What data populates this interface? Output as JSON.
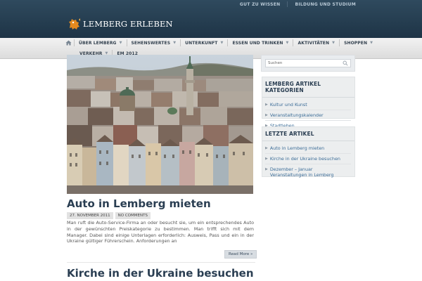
{
  "header": {
    "top_links": [
      "GUT ZU WISSEN",
      "BILDUNG UND STUDIUM"
    ],
    "logo_text": "LEMBERG ERLEBEN",
    "colors": {
      "header_bg": "#243c4f",
      "accent": "#e58a1f"
    }
  },
  "nav": {
    "home_icon": "home-icon",
    "items": [
      {
        "label": "ÜBER LEMBERG"
      },
      {
        "label": "SEHENSWERTES"
      },
      {
        "label": "UNTERKUNFT"
      },
      {
        "label": "ESSEN UND TRINKEN"
      },
      {
        "label": "AKTIVITÄTEN"
      },
      {
        "label": "SHOPPEN"
      },
      {
        "label": "VERKEHR"
      },
      {
        "label": "EM 2012"
      }
    ]
  },
  "posts": [
    {
      "title": "Auto in Lemberg mieten",
      "date": "27. NOVEMBER 2011",
      "comments": "NO COMMENTS",
      "excerpt": "Man ruft die Auto-Service-Firma an oder besucht sie, um ein entsprechendes Auto in der gewünschten Preiskategorie zu bestimmen. Man trifft sich mit dem Manager. Dabei sind einige Unterlagen erforderlich: Ausweis, Pass und ein in der Ukraine gültiger Führerschein. Anforderungen an",
      "read_more": "Read More »"
    },
    {
      "title": "Kirche in der Ukraine besuchen"
    }
  ],
  "sidebar": {
    "search_placeholder": "Suchen",
    "categories": {
      "title": "LEMBERG ARTIKEL KATEGORIEN",
      "items": [
        "Kultur und Kunst",
        "Veranstaltungskalender",
        "Stadtleben"
      ]
    },
    "recent": {
      "title": "LETZTE ARTIKEL",
      "items": [
        "Auto in Lemberg mieten",
        "Kirche in der Ukraine besuchen",
        "Dezember – Januar Veranstaltungen in Lemberg"
      ]
    }
  }
}
